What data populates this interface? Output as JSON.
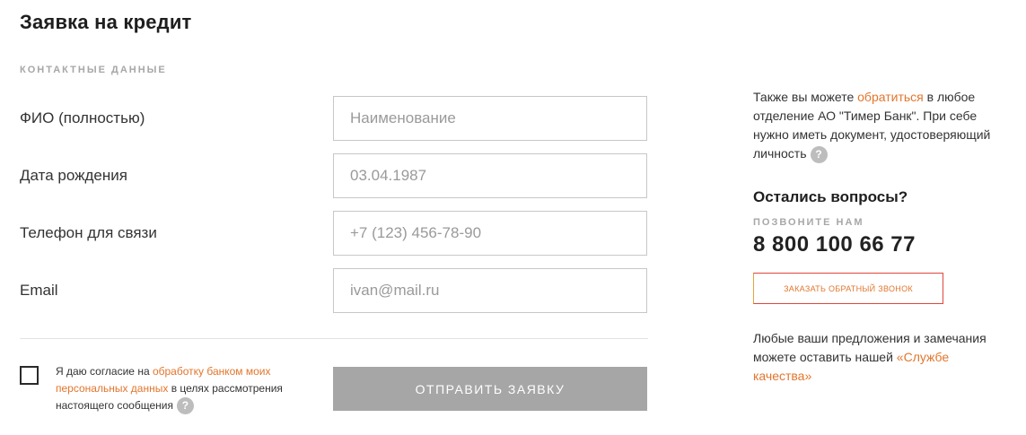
{
  "page": {
    "title": "Заявка на кредит",
    "section_label": "КОНТАКТНЫЕ ДАННЫЕ"
  },
  "form": {
    "fields": [
      {
        "label": "ФИО (полностью)",
        "placeholder": "Наименование",
        "value": ""
      },
      {
        "label": "Дата рождения",
        "placeholder": "03.04.1987",
        "value": ""
      },
      {
        "label": "Телефон для связи",
        "placeholder": "+7 (123) 456-78-90",
        "value": ""
      },
      {
        "label": "Email",
        "placeholder": "ivan@mail.ru",
        "value": ""
      }
    ],
    "consent": {
      "text_before": "Я даю согласие на ",
      "link": "обработку банком моих персональных данных",
      "text_after": " в целях рассмотрения настоящего сообщения",
      "checked": false,
      "help_icon": "question-icon",
      "help_glyph": "?"
    },
    "submit_label": "ОТПРАВИТЬ ЗАЯВКУ"
  },
  "aside": {
    "info": {
      "text_before": "Также вы можете ",
      "link": "обратиться",
      "text_after": " в любое отделение АО \"Тимер Банк\". При себе нужно иметь документ, удостоверяющий личность",
      "help_icon": "question-icon",
      "help_glyph": "?"
    },
    "questions_heading": "Остались вопросы?",
    "call_label": "ПОЗВОНИТЕ НАМ",
    "phone": "8 800 100 66 77",
    "callback_button": "ЗАКАЗАТЬ ОБРАТНЫЙ ЗВОНОК",
    "feedback": {
      "text_before": "Любые ваши предложения и замечания можете оставить нашей ",
      "link": "«Службе качества»"
    }
  },
  "colors": {
    "accent": "#e2762d",
    "button_disabled": "#a6a6a6",
    "muted_label": "#a7a7a7",
    "callback_border": "#e0463a"
  }
}
